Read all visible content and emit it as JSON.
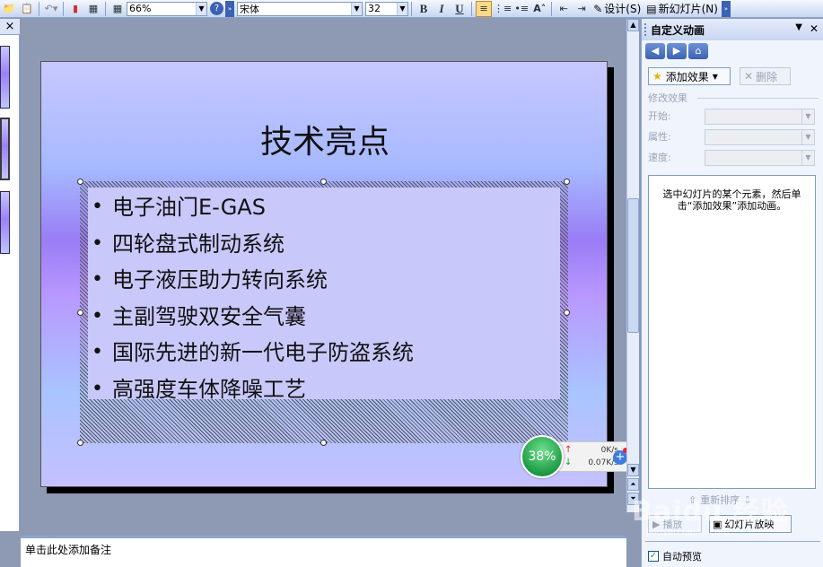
{
  "toolbar": {
    "zoom": "66%",
    "font_name": "宋体",
    "font_size": "32",
    "bold_label": "B",
    "italic_label": "I",
    "underline_label": "U",
    "design_label": "设计(S)",
    "new_slide_label": "新幻灯片(N)"
  },
  "slide": {
    "title": "技术亮点",
    "bullets": [
      "电子油门E-GAS",
      "四轮盘式制动系统",
      "电子液压助力转向系统",
      "主副驾驶双安全气囊",
      "国际先进的新一代电子防盗系统",
      "高强度车体降噪工艺"
    ]
  },
  "net_widget": {
    "percent": "38%",
    "upload": "0K/s",
    "download": "0.07K/s"
  },
  "notes": {
    "placeholder": "单击此处添加备注"
  },
  "task_pane": {
    "title": "自定义动画",
    "add_effect": "添加效果",
    "remove": "删除",
    "modify_label": "修改效果",
    "start_label": "开始:",
    "property_label": "属性:",
    "speed_label": "速度:",
    "hint": "选中幻灯片的某个元素，然后单击“添加效果”添加动画。",
    "reorder_label": "重新排序",
    "play_label": "播放",
    "slideshow_label": "幻灯片放映",
    "autopreview_label": "自动预览",
    "autopreview_checked": true
  },
  "watermark": {
    "text": "Baidu 经验",
    "sub": "jingyan.baidu.com"
  },
  "colors": {
    "toolbar_bg": "#c7d6f1",
    "workspace_bg": "#8e99b3",
    "net_green": "#1e9a45"
  }
}
